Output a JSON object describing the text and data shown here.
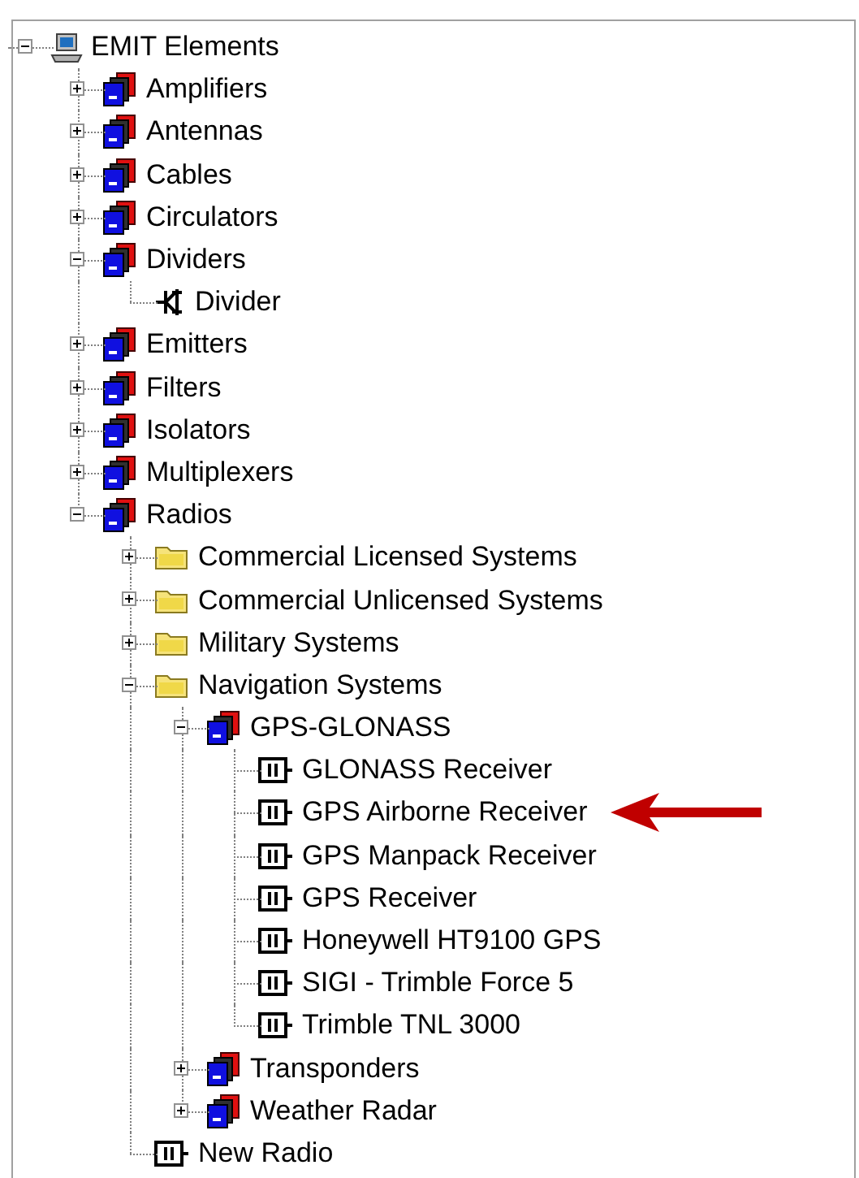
{
  "tree": {
    "label": "EMIT Elements",
    "kind": "computer",
    "expanded": true,
    "children": [
      {
        "label": "Amplifiers",
        "kind": "stack",
        "expanded": false
      },
      {
        "label": "Antennas",
        "kind": "stack",
        "expanded": false
      },
      {
        "label": "Cables",
        "kind": "stack",
        "expanded": false
      },
      {
        "label": "Circulators",
        "kind": "stack",
        "expanded": false
      },
      {
        "label": "Dividers",
        "kind": "stack",
        "expanded": true,
        "children": [
          {
            "label": "Divider",
            "kind": "divider"
          }
        ]
      },
      {
        "label": "Emitters",
        "kind": "stack",
        "expanded": false
      },
      {
        "label": "Filters",
        "kind": "stack",
        "expanded": false
      },
      {
        "label": "Isolators",
        "kind": "stack",
        "expanded": false
      },
      {
        "label": "Multiplexers",
        "kind": "stack",
        "expanded": false
      },
      {
        "label": "Radios",
        "kind": "stack",
        "expanded": true,
        "children": [
          {
            "label": "Commercial Licensed Systems",
            "kind": "folder",
            "expanded": false
          },
          {
            "label": "Commercial Unlicensed Systems",
            "kind": "folder",
            "expanded": false
          },
          {
            "label": "Military Systems",
            "kind": "folder",
            "expanded": false
          },
          {
            "label": "Navigation Systems",
            "kind": "folder",
            "expanded": true,
            "children": [
              {
                "label": "GPS-GLONASS",
                "kind": "stack",
                "expanded": true,
                "children": [
                  {
                    "label": "GLONASS Receiver",
                    "kind": "component",
                    "marked": false
                  },
                  {
                    "label": "GPS Airborne Receiver",
                    "kind": "component",
                    "marked": true
                  },
                  {
                    "label": "GPS Manpack Receiver",
                    "kind": "component",
                    "marked": false
                  },
                  {
                    "label": "GPS Receiver",
                    "kind": "component",
                    "marked": false
                  },
                  {
                    "label": "Honeywell HT9100 GPS",
                    "kind": "component",
                    "marked": false
                  },
                  {
                    "label": "SIGI - Trimble Force 5",
                    "kind": "component",
                    "marked": false
                  },
                  {
                    "label": "Trimble TNL 3000",
                    "kind": "component",
                    "marked": false
                  }
                ]
              },
              {
                "label": "Transponders",
                "kind": "stack",
                "expanded": false
              },
              {
                "label": "Weather Radar",
                "kind": "stack",
                "expanded": false
              }
            ]
          },
          {
            "label": "New Radio",
            "kind": "component"
          }
        ]
      }
    ]
  }
}
